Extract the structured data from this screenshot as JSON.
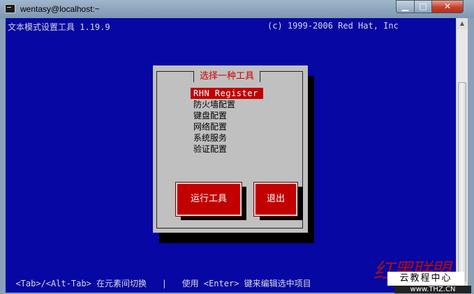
{
  "window": {
    "title": "wentasy@localhost:~",
    "min_label": "▁",
    "max_label": "□",
    "close_label": "✕"
  },
  "terminal": {
    "header_left": "文本模式设置工具 1.19.9",
    "header_right": "(c) 1999-2006 Red Hat, Inc",
    "status_line": "  <Tab>/<Alt-Tab> 在元素间切换   |   使用 <Enter> 键来编辑选中项目"
  },
  "dialog": {
    "title": "选择一种工具",
    "items": [
      {
        "label": "RHN Register",
        "selected": true
      },
      {
        "label": "防火墙配置",
        "selected": false
      },
      {
        "label": "键盘配置",
        "selected": false
      },
      {
        "label": "网络配置",
        "selected": false
      },
      {
        "label": "系统服务",
        "selected": false
      },
      {
        "label": "验证配置",
        "selected": false
      }
    ],
    "run_button": "运行工具",
    "quit_button": "退出"
  },
  "watermark": {
    "script": "红黑联盟",
    "box": "云教程中心",
    "url": "www.THZ.CN"
  },
  "colors": {
    "terminal_bg": "#0707a3",
    "dialog_bg": "#c0c0c0",
    "accent": "#c20000",
    "title_red": "#cc0000"
  },
  "icons": {
    "window": "terminal-icon",
    "scroll_up": "arrow-up-icon",
    "scroll_down": "arrow-down-icon"
  }
}
